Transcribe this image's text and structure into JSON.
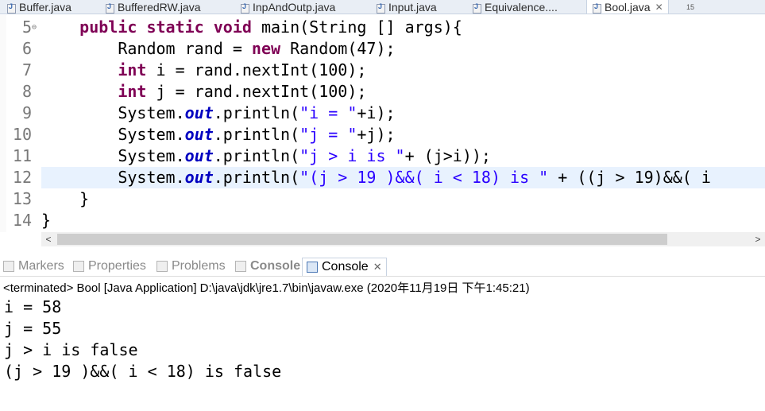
{
  "tabs": [
    {
      "label": "Buffer.java",
      "active": false
    },
    {
      "label": "BufferedRW.java",
      "active": false
    },
    {
      "label": "InpAndOutp.java",
      "active": false
    },
    {
      "label": "Input.java",
      "active": false
    },
    {
      "label": "Equivalence....",
      "active": false
    },
    {
      "label": "Bool.java",
      "active": true
    }
  ],
  "tab_close": "✕",
  "tab_overflow": "15",
  "editor": {
    "lines": [
      {
        "num": "5",
        "fold": "⊖",
        "tokens": [
          {
            "t": "    ",
            "c": "plain"
          },
          {
            "t": "public",
            "c": "kw"
          },
          {
            "t": " ",
            "c": "plain"
          },
          {
            "t": "static",
            "c": "kw"
          },
          {
            "t": " ",
            "c": "plain"
          },
          {
            "t": "void",
            "c": "kw"
          },
          {
            "t": " main(String [] args){",
            "c": "plain"
          }
        ]
      },
      {
        "num": "6",
        "tokens": [
          {
            "t": "        Random rand = ",
            "c": "plain"
          },
          {
            "t": "new",
            "c": "kw"
          },
          {
            "t": " Random(47);",
            "c": "plain"
          }
        ]
      },
      {
        "num": "7",
        "tokens": [
          {
            "t": "        ",
            "c": "plain"
          },
          {
            "t": "int",
            "c": "kw"
          },
          {
            "t": " i = rand.nextInt(100);",
            "c": "plain"
          }
        ]
      },
      {
        "num": "8",
        "tokens": [
          {
            "t": "        ",
            "c": "plain"
          },
          {
            "t": "int",
            "c": "kw"
          },
          {
            "t": " j = rand.nextInt(100);",
            "c": "plain"
          }
        ]
      },
      {
        "num": "9",
        "tokens": [
          {
            "t": "        System.",
            "c": "plain"
          },
          {
            "t": "out",
            "c": "fld"
          },
          {
            "t": ".println(",
            "c": "plain"
          },
          {
            "t": "\"i = \"",
            "c": "str"
          },
          {
            "t": "+i);",
            "c": "plain"
          }
        ]
      },
      {
        "num": "10",
        "tokens": [
          {
            "t": "        System.",
            "c": "plain"
          },
          {
            "t": "out",
            "c": "fld"
          },
          {
            "t": ".println(",
            "c": "plain"
          },
          {
            "t": "\"j = \"",
            "c": "str"
          },
          {
            "t": "+j);",
            "c": "plain"
          }
        ]
      },
      {
        "num": "11",
        "tokens": [
          {
            "t": "        System.",
            "c": "plain"
          },
          {
            "t": "out",
            "c": "fld"
          },
          {
            "t": ".println(",
            "c": "plain"
          },
          {
            "t": "\"j > i is \"",
            "c": "str"
          },
          {
            "t": "+ (j>i));",
            "c": "plain"
          }
        ]
      },
      {
        "num": "12",
        "current": true,
        "tokens": [
          {
            "t": "        System.",
            "c": "plain"
          },
          {
            "t": "out",
            "c": "fld"
          },
          {
            "t": ".println(",
            "c": "plain"
          },
          {
            "t": "\"(j > 19 )&&( i < 18) is \"",
            "c": "str"
          },
          {
            "t": " + ((j > 19)&&( i",
            "c": "plain"
          }
        ]
      },
      {
        "num": "13",
        "tokens": [
          {
            "t": "    }",
            "c": "plain"
          }
        ]
      },
      {
        "num": "14",
        "tokens": [
          {
            "t": "}",
            "c": "plain"
          }
        ]
      }
    ]
  },
  "scrollbar": {
    "left_arrow": "<",
    "right_arrow": ">"
  },
  "panel_tabs": [
    {
      "label": "Markers",
      "active": false,
      "bold": false
    },
    {
      "label": "Properties",
      "active": false,
      "bold": false
    },
    {
      "label": "Problems",
      "active": false,
      "bold": false
    },
    {
      "label": "Console",
      "active": false,
      "bold": true
    },
    {
      "label": "Console",
      "active": true,
      "bold": false
    }
  ],
  "console": {
    "header": "<terminated> Bool [Java Application] D:\\java\\jdk\\jre1.7\\bin\\javaw.exe (2020年11月19日 下午1:45:21)",
    "output": [
      "i = 58",
      "j = 55",
      "j > i is false",
      "(j > 19 )&&( i < 18) is false"
    ]
  }
}
